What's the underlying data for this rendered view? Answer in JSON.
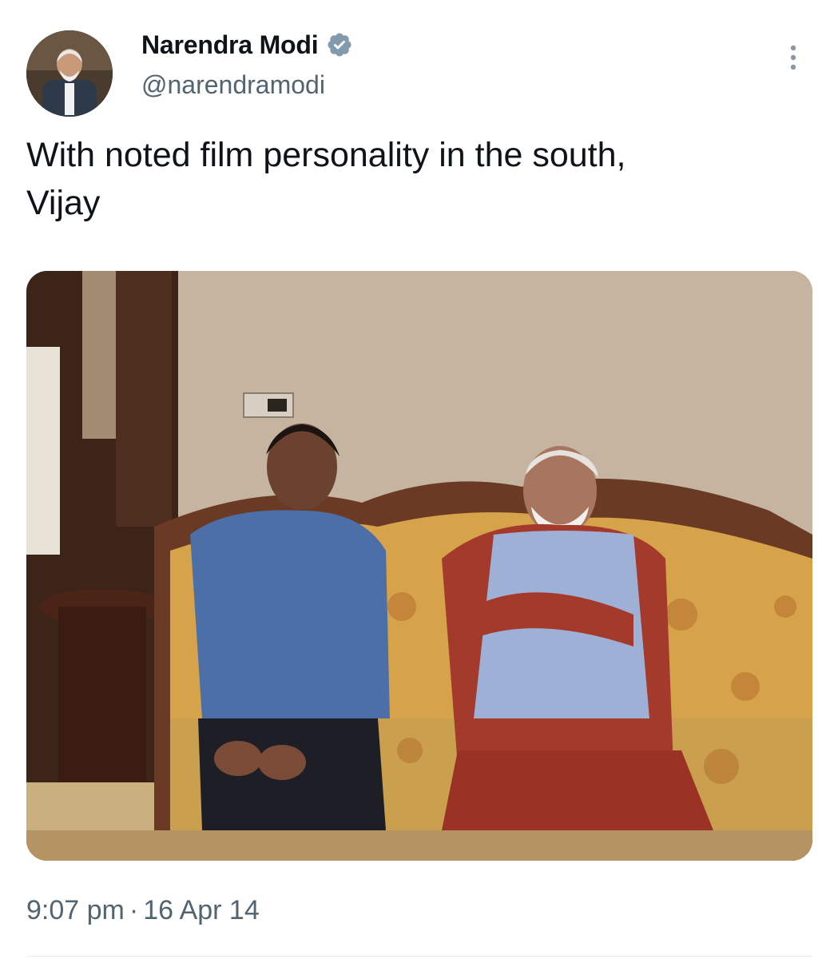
{
  "tweet": {
    "author": {
      "display_name": "Narendra Modi",
      "handle": "@narendramodi",
      "verified_icon": "verified-badge-icon",
      "avatar_icon": "profile-photo"
    },
    "menu_icon": "more-options-icon",
    "text": "With noted film personality in the south,\nVijay",
    "media_icon": "photo-two-men-seated-on-sofa",
    "time": "9:07 pm",
    "separator": "·",
    "date": "16 Apr 14"
  },
  "colors": {
    "primary_text": "#0f1419",
    "secondary_text": "#536471",
    "verified_badge": "#829aab"
  }
}
